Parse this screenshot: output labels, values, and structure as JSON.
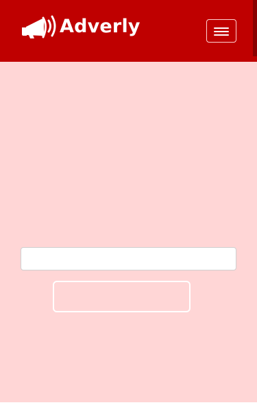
{
  "brand": {
    "name": "Adverly",
    "logo_icon": "megaphone-icon"
  },
  "nav": {
    "toggle_icon": "hamburger-menu-icon",
    "toggle_label": ""
  },
  "form": {
    "input_value": "",
    "input_placeholder": "",
    "button_label": ""
  },
  "colors": {
    "navbar_bg": "#bf0000",
    "content_bg": "#ffd6d6",
    "brand_text": "#ffffff"
  }
}
